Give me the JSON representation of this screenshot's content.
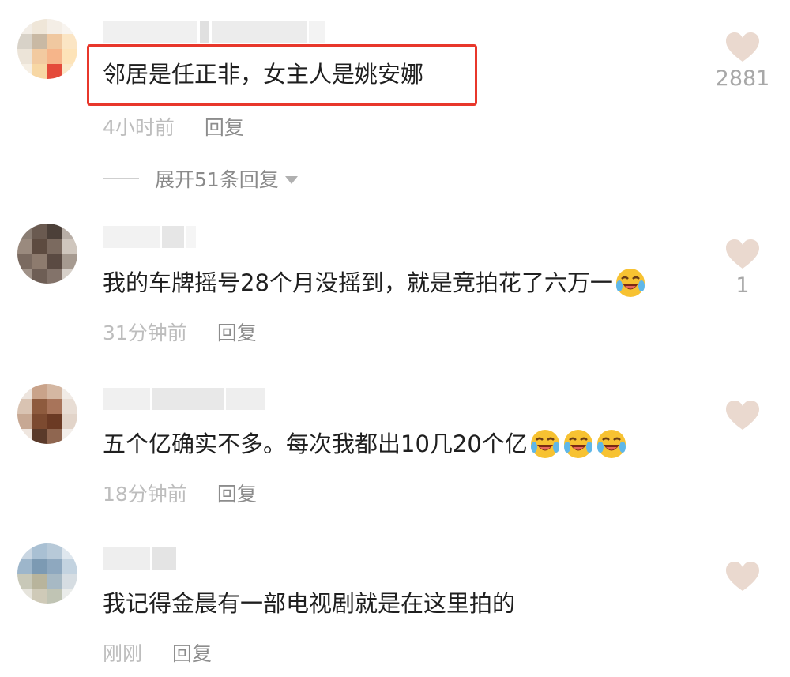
{
  "comments": [
    {
      "text": "邻居是任正非，女主人是姚安娜",
      "time": "4小时前",
      "reply_label": "回复",
      "likes": "2881",
      "expand_label": "展开51条回复"
    },
    {
      "text": "我的车牌摇号28个月没摇到，就是竞拍花了六万一",
      "time": "31分钟前",
      "reply_label": "回复",
      "likes": "1",
      "emoji_count": 1
    },
    {
      "text": "五个亿确实不多。每次我都出10几20个亿",
      "time": "18分钟前",
      "reply_label": "回复",
      "likes": "",
      "emoji_count": 3
    },
    {
      "text": "我记得金晨有一部电视剧就是在这里拍的",
      "time": "刚刚",
      "reply_label": "回复",
      "likes": ""
    }
  ],
  "colors": {
    "highlight": "#e8372b",
    "heart": "#ead9cf",
    "meta_time": "#bdbdbd",
    "meta_reply": "#8c8c8c"
  },
  "icons": {
    "like": "heart-icon",
    "emoji": "laugh-cry-emoji-icon",
    "expand": "caret-down-icon"
  }
}
